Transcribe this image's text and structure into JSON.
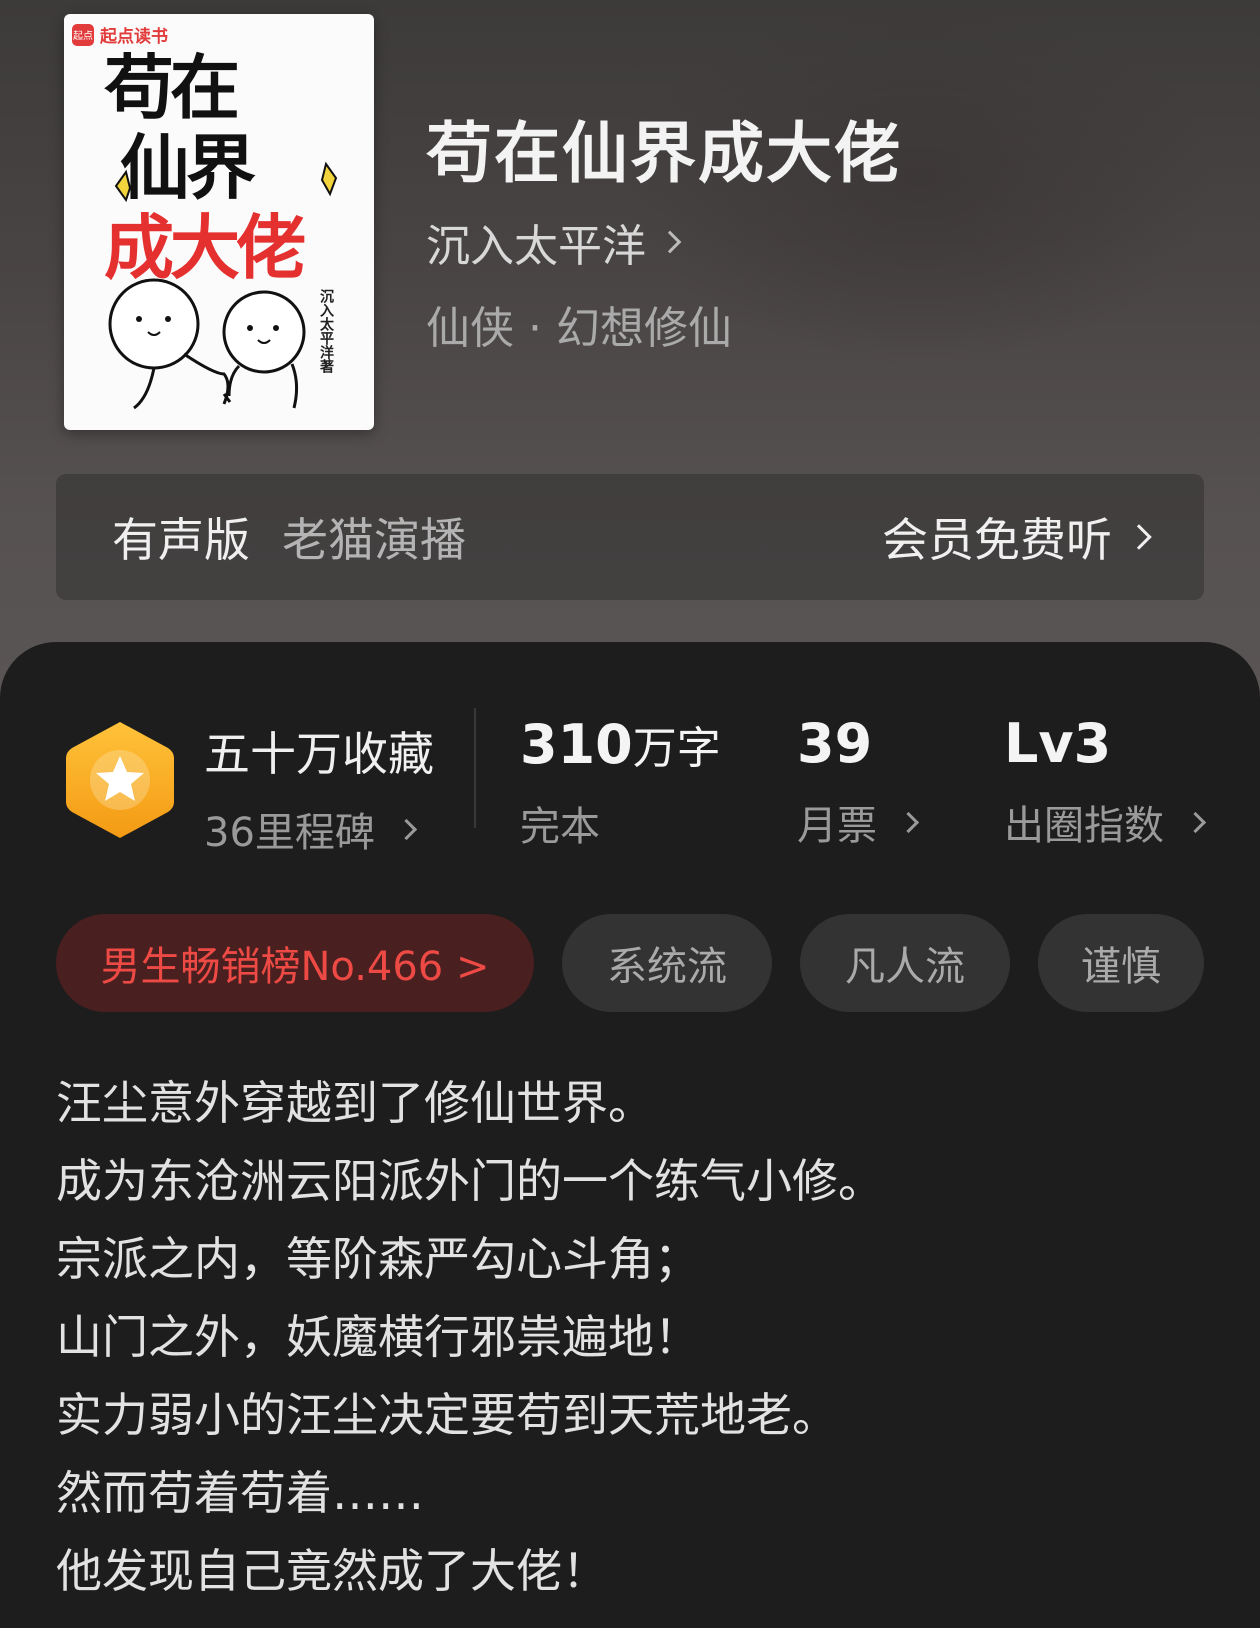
{
  "book": {
    "title": "苟在仙界成大佬",
    "author": "沉入太平洋",
    "genre": "仙侠 · 幻想修仙"
  },
  "cover": {
    "brand": "起点读书",
    "brand_mark": "起点",
    "title_lines": [
      "苟在",
      "仙界",
      "成大佬"
    ],
    "author_vertical": "沉入太平洋著"
  },
  "audio": {
    "label": "有声版",
    "narrator": "老猫演播",
    "cta": "会员免费听"
  },
  "stats": {
    "collect": {
      "title": "五十万收藏",
      "milestone": "36里程碑"
    },
    "words": {
      "value": "310",
      "unit": "万字",
      "status": "完本"
    },
    "tickets": {
      "value": "39",
      "label": "月票"
    },
    "circle": {
      "value": "Lv3",
      "label": "出圈指数"
    }
  },
  "tags": {
    "rank": "男生畅销榜No.466 >",
    "items": [
      "系统流",
      "凡人流",
      "谨慎"
    ]
  },
  "description": [
    "汪尘意外穿越到了修仙世界。",
    "成为东沧洲云阳派外门的一个练气小修。",
    "宗派之内，等阶森严勾心斗角；",
    "山门之外，妖魔横行邪祟遍地！",
    "实力弱小的汪尘决定要苟到天荒地老。",
    "然而苟着苟着……",
    "他发现自己竟然成了大佬！"
  ],
  "colors": {
    "accent_red": "#ee4a45",
    "badge_orange": "#f6a21c"
  },
  "icons": {
    "badge": "star-hexagon-icon",
    "chevron": "chevron-right-icon"
  }
}
